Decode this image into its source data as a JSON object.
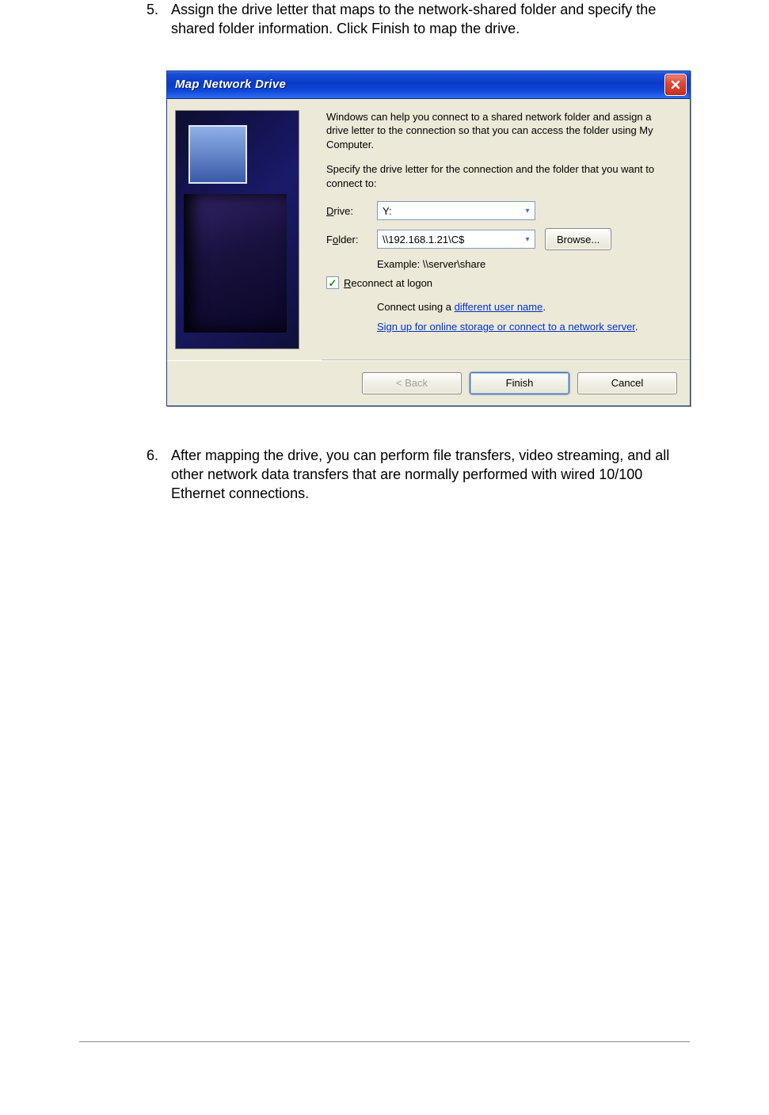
{
  "step5": {
    "num": "5.",
    "text": "Assign the drive letter that maps to the network-shared folder and specify the shared folder information. Click Finish to map the drive."
  },
  "step6": {
    "num": "6.",
    "text": "After mapping the drive, you can perform file transfers, video streaming, and all other network data transfers that are normally performed with wired 10/100 Ethernet connections."
  },
  "dialog": {
    "title": "Map Network Drive",
    "intro": "Windows can help you connect to a shared network folder and assign a drive letter to the connection so that you can access the folder using My Computer.",
    "specify": "Specify the drive letter for the connection and the folder that you want to connect to:",
    "drive_label": "Drive:",
    "drive_value": "Y:",
    "folder_label": "Folder:",
    "folder_value": "\\\\192.168.1.21\\C$",
    "browse": "Browse...",
    "example": "Example: \\\\server\\share",
    "reconnect": "Reconnect at logon",
    "connect_pre": "Connect using a ",
    "connect_link": "different user name",
    "signup_link": "Sign up for online storage or connect to a network server",
    "back": "< Back",
    "finish": "Finish",
    "cancel": "Cancel"
  }
}
